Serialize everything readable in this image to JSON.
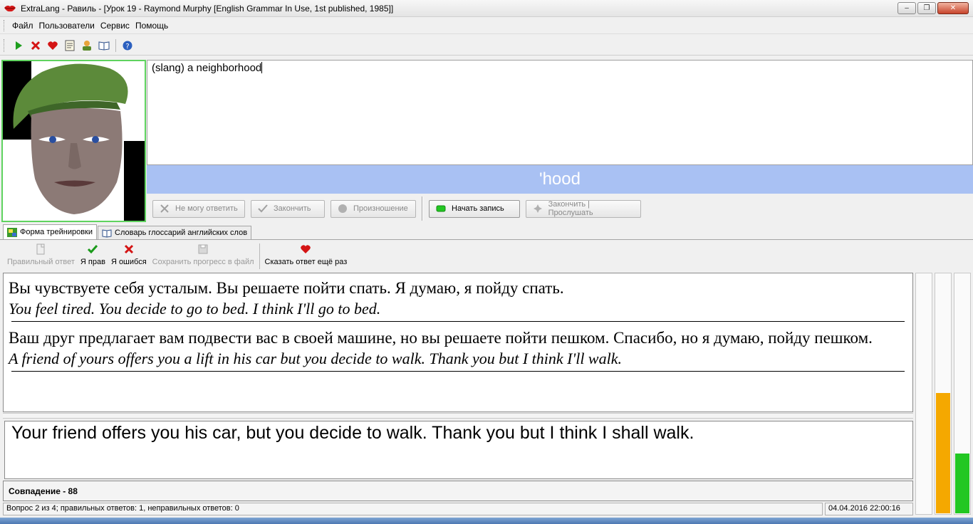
{
  "window": {
    "title": "ExtraLang - Равиль - [Урок 19 - Raymond Murphy [English Grammar In Use, 1st published, 1985]]",
    "controls": [
      "minimize",
      "restore",
      "close"
    ]
  },
  "menu": [
    "Файл",
    "Пользователи",
    "Сервис",
    "Помощь"
  ],
  "toolbar_icons": [
    "play-icon",
    "stop-icon",
    "heart-icon",
    "notepad-icon",
    "user-icon",
    "book-icon",
    "help-icon"
  ],
  "prompt": {
    "definition": "(slang) a neighborhood",
    "word": "'hood"
  },
  "actions": [
    {
      "label": "Не могу ответить",
      "enabled": false,
      "icon": "cross-icon"
    },
    {
      "label": "Закончить",
      "enabled": false,
      "icon": "check-icon"
    },
    {
      "label": "Произношение",
      "enabled": false,
      "icon": "circle-icon"
    },
    {
      "label": "Начать запись",
      "enabled": true,
      "icon": "record-icon"
    },
    {
      "label": "Закончить | Прослушать",
      "enabled": false,
      "icon": "listen-icon"
    }
  ],
  "tabs": [
    "Форма трейнировки",
    "Словарь глоссарий английских слов"
  ],
  "training_toolbar": [
    {
      "label": "Правильный ответ",
      "enabled": false,
      "icon": "document-icon"
    },
    {
      "label": "Я прав",
      "enabled": true,
      "icon": "checkmark-icon"
    },
    {
      "label": "Я ошибся",
      "enabled": true,
      "icon": "cross-icon"
    },
    {
      "label": "Сохранить прогресс в файл",
      "enabled": false,
      "icon": "floppy-icon"
    },
    {
      "label": "Сказать ответ ещё раз",
      "enabled": true,
      "icon": "heart-icon"
    }
  ],
  "sentences": [
    {
      "ru": "Вы чувствуете себя усталым. Вы решаете пойти спать. Я думаю, я пойду спать.",
      "en": "You feel tired. You decide to go to bed. I think I'll go to bed."
    },
    {
      "ru": "Ваш друг предлагает вам подвести вас в своей машине, но вы решаете пойти пешком. Спасибо, но я думаю, пойду пешком.",
      "en": "A friend of yours offers you a lift in his car but you decide to walk. Thank you but I think I'll walk."
    }
  ],
  "answer": "Your friend offers you his car, but you decide to walk. Thank you but I think I shall walk.",
  "match_text": "Совпадение - 88",
  "meters": [
    {
      "name": "orange-meter",
      "level": 0.5,
      "color": "#f5a800"
    },
    {
      "name": "green-meter",
      "level": 0.25,
      "color": "#22c722"
    }
  ],
  "status": {
    "progress": "Вопрос 2 из 4; правильных ответов: 1, неправильных ответов: 0",
    "datetime": "04.04.2016 22:00:16"
  }
}
